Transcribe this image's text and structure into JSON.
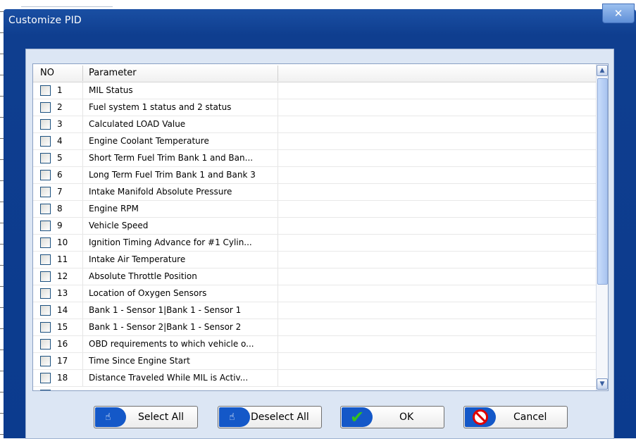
{
  "window": {
    "title": "Customize PID",
    "close_glyph": "✕"
  },
  "table": {
    "columns": [
      "NO",
      "Parameter"
    ],
    "rows": [
      {
        "no": "1",
        "param": "MIL Status"
      },
      {
        "no": "2",
        "param": "Fuel system 1 status and 2 status"
      },
      {
        "no": "3",
        "param": "Calculated LOAD Value"
      },
      {
        "no": "4",
        "param": "Engine Coolant Temperature"
      },
      {
        "no": "5",
        "param": "Short Term Fuel Trim Bank 1 and Ban..."
      },
      {
        "no": "6",
        "param": "Long Term Fuel Trim Bank 1 and Bank 3"
      },
      {
        "no": "7",
        "param": "Intake Manifold Absolute Pressure"
      },
      {
        "no": "8",
        "param": "Engine RPM"
      },
      {
        "no": "9",
        "param": "Vehicle Speed"
      },
      {
        "no": "10",
        "param": "Ignition Timing Advance for #1 Cylin..."
      },
      {
        "no": "11",
        "param": "Intake Air Temperature"
      },
      {
        "no": "12",
        "param": "Absolute Throttle Position"
      },
      {
        "no": "13",
        "param": "Location of Oxygen Sensors"
      },
      {
        "no": "14",
        "param": "Bank 1 - Sensor 1|Bank 1 - Sensor 1"
      },
      {
        "no": "15",
        "param": "Bank 1 - Sensor 2|Bank 1 - Sensor 2"
      },
      {
        "no": "16",
        "param": "OBD requirements to which vehicle o..."
      },
      {
        "no": "17",
        "param": "Time Since Engine Start"
      },
      {
        "no": "18",
        "param": "Distance Traveled While MIL is Activ..."
      }
    ]
  },
  "buttons": {
    "select_all": "Select All",
    "deselect_all": "Deselect All",
    "ok": "OK",
    "cancel": "Cancel"
  },
  "colors": {
    "title_bar": "#0b3b8e",
    "panel": "#dce6f4",
    "icon_blue": "#1458c8",
    "check_green": "#35c11d",
    "cancel_red": "#e00000"
  },
  "icons": {
    "select_all": "pointing-hand-icon",
    "deselect_all": "pointing-hand-icon",
    "ok": "checkmark-icon",
    "cancel": "no-entry-icon"
  }
}
